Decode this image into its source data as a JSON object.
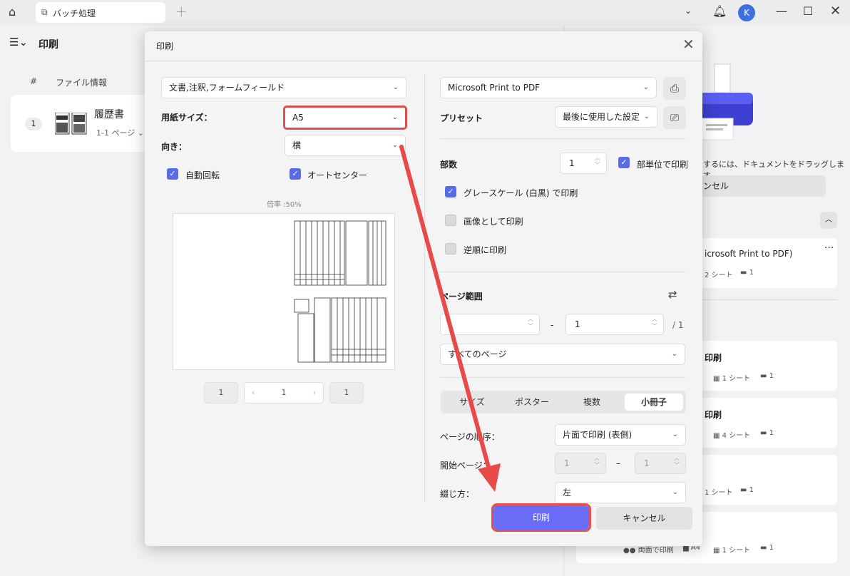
{
  "titlebar": {
    "tab_label": "バッチ処理",
    "avatar_letter": "K"
  },
  "sidebar": {
    "title": "印刷",
    "col_num": "#",
    "col_info": "ファイル情報",
    "file": {
      "index": "1",
      "name": "履歴書",
      "pages": "1-1 ページ"
    }
  },
  "right_panel": {
    "drag_hint": "するには、ドキュメントをドラッグします。",
    "cancel_label": "ンセル",
    "cards": [
      {
        "title": "icrosoft Print to PDF)",
        "meta1": "2 シート",
        "meta2": "1"
      },
      {
        "title": "印刷",
        "meta1": "1 シート",
        "meta2": "1"
      },
      {
        "title": "印刷",
        "meta1": "4 シート",
        "meta2": "1"
      },
      {
        "title": "",
        "meta1": "1 シート",
        "meta2": "1"
      },
      {
        "title": "",
        "meta0": "両面で印刷",
        "meta_size": "A4",
        "meta1": "1 シート",
        "meta2": "1"
      }
    ]
  },
  "dialog": {
    "title": "印刷",
    "content_select": "文書,注釈,フォームフィールド",
    "paper_size_label": "用紙サイズ：",
    "paper_size": "A5",
    "orientation_label": "向き：",
    "orientation": "横",
    "auto_rotate": "自動回転",
    "auto_center": "オートセンター",
    "zoom": "倍率 :50%",
    "pager": {
      "first": "1",
      "current": "1",
      "last": "1"
    },
    "printer": "Microsoft Print to PDF",
    "preset_label": "プリセット",
    "preset": "最後に使用した設定",
    "copies_label": "部数",
    "copies": "1",
    "collate": "部単位で印刷",
    "grayscale": "グレースケール (白黒) で印刷",
    "as_image": "画像として印刷",
    "reverse": "逆順に印刷",
    "page_range_label": "ページ範囲",
    "range_to": "1",
    "range_total": "/ 1",
    "range_dash": "-",
    "all_pages": "すべてのページ",
    "seg_tabs": [
      "サイズ",
      "ポスター",
      "複数",
      "小冊子"
    ],
    "page_order_label": "ページの順序：",
    "page_order": "片面で印刷 (表側)",
    "start_page_label": "開始ページ：",
    "start_from": "1",
    "start_to": "1",
    "binding_label": "綴じ方：",
    "binding": "左",
    "print_button": "印刷",
    "cancel_button": "キャンセル"
  },
  "colors": {
    "accent": "#6b6cf6",
    "highlight": "#e04d4d"
  }
}
